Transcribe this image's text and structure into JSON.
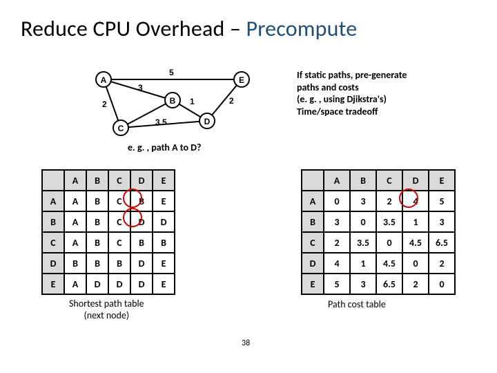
{
  "title": {
    "main": "Reduce CPU Overhead – ",
    "highlight": "Precompute"
  },
  "graph": {
    "nodes": [
      "A",
      "B",
      "C",
      "D",
      "E"
    ],
    "edges": [
      {
        "from": "A",
        "to": "E",
        "w": "5"
      },
      {
        "from": "A",
        "to": "B",
        "w": "3"
      },
      {
        "from": "A",
        "to": "C",
        "w": "2"
      },
      {
        "from": "B",
        "to": "C",
        "w": "3.5"
      },
      {
        "from": "B",
        "to": "D",
        "w": "1"
      },
      {
        "from": "D",
        "to": "E",
        "w": "2"
      }
    ],
    "caption": "e. g. , path A to D?"
  },
  "description": {
    "l1": "If static paths, pre-generate",
    "l2": "paths and costs",
    "l3": "(e. g. , using Djikstra's)",
    "l4": "Time/space tradeoff"
  },
  "chart_data": [
    {
      "type": "table",
      "title": "Shortest path table (next node)",
      "row_labels": [
        "A",
        "B",
        "C",
        "D",
        "E"
      ],
      "col_labels": [
        "A",
        "B",
        "C",
        "D",
        "E"
      ],
      "rows": [
        [
          "A",
          "B",
          "C",
          "B",
          "E"
        ],
        [
          "A",
          "B",
          "C",
          "D",
          "D"
        ],
        [
          "A",
          "B",
          "C",
          "B",
          "B"
        ],
        [
          "B",
          "B",
          "B",
          "D",
          "E"
        ],
        [
          "A",
          "D",
          "D",
          "D",
          "E"
        ]
      ],
      "highlights": [
        [
          0,
          3
        ],
        [
          1,
          3
        ]
      ]
    },
    {
      "type": "table",
      "title": "Path cost table",
      "row_labels": [
        "A",
        "B",
        "C",
        "D",
        "E"
      ],
      "col_labels": [
        "A",
        "B",
        "C",
        "D",
        "E"
      ],
      "rows": [
        [
          "0",
          "3",
          "2",
          "4",
          "5"
        ],
        [
          "3",
          "0",
          "3.5",
          "1",
          "3"
        ],
        [
          "2",
          "3.5",
          "0",
          "4.5",
          "6.5"
        ],
        [
          "4",
          "1",
          "4.5",
          "0",
          "2"
        ],
        [
          "5",
          "3",
          "6.5",
          "2",
          "0"
        ]
      ],
      "highlights": [
        [
          0,
          3
        ]
      ]
    }
  ],
  "labels": {
    "left1": "Shortest path table",
    "left2": "(next node)",
    "right": "Path cost table"
  },
  "page": "38"
}
